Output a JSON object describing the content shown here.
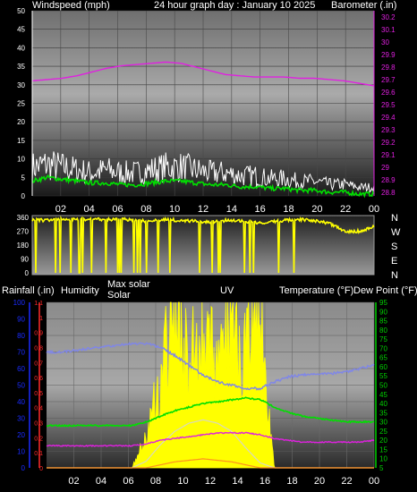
{
  "header": {
    "wind_label": "Windspeed (mph)",
    "title": "24 hour graph day : January 10 2025",
    "baro_label": "Barometer (.in)"
  },
  "lower_labels": {
    "rain": "Rainfall (.in)",
    "humidity": "Humidity",
    "max_solar": "Max solar",
    "solar": "Solar",
    "uv": "UV",
    "temp": "Temperature (°F)",
    "dew": "Dew Point (°F)"
  },
  "direction_labels": [
    "N",
    "W",
    "S",
    "E",
    "N"
  ],
  "x_ticks": [
    "02",
    "04",
    "06",
    "08",
    "10",
    "12",
    "14",
    "16",
    "18",
    "20",
    "22",
    "00"
  ],
  "colors": {
    "wind_avg": "#00e000",
    "wind_gust": "#ffffff",
    "barometer": "#e020e0",
    "direction": "#ffff00",
    "solar": "#ffff00",
    "max_solar": "#d8d8c0",
    "uv": "#ff9020",
    "temperature": "#00e000",
    "dew_point": "#e020e0",
    "humidity": "#7f86e8",
    "rain_axis": "#1a2cff",
    "uv_axis": "#ff2a2a",
    "temp_axis": "#00d000"
  },
  "chart_data": [
    {
      "type": "line",
      "name": "wind-barometer",
      "x": [
        "02",
        "04",
        "06",
        "08",
        "10",
        "12",
        "14",
        "16",
        "18",
        "20",
        "22",
        "00"
      ],
      "y_left": {
        "ticks": [
          0,
          5,
          10,
          15,
          20,
          25,
          30,
          35,
          40,
          45,
          50
        ],
        "ylim": [
          0,
          50
        ]
      },
      "y_right": {
        "ticks": [
          28.8,
          28.9,
          29.0,
          29.1,
          29.2,
          29.3,
          29.4,
          29.5,
          29.6,
          29.7,
          29.8,
          29.9,
          30.0,
          30.1,
          30.2
        ],
        "tick_labels": [
          "28.8",
          "28.9",
          "29",
          "29.1",
          "29.2",
          "29.3",
          "29.4",
          "29.5",
          "29.6",
          "29.7",
          "29.8",
          "29.9",
          "30",
          "30.1",
          "30.2"
        ],
        "ylim": [
          28.77,
          30.25
        ]
      },
      "series": [
        {
          "name": "Windspeed",
          "axis": "left",
          "values": [
            4,
            5,
            4.5,
            4,
            3.5,
            3.5,
            3,
            3,
            3.5,
            4,
            4,
            3.5,
            3,
            3,
            2.5,
            2.5,
            2,
            2,
            1.5,
            1.5,
            1,
            1,
            0.5,
            0.5
          ]
        },
        {
          "name": "Gust",
          "axis": "left",
          "values": [
            10,
            11,
            10,
            9,
            8,
            9,
            8,
            8,
            9,
            10,
            10,
            9,
            8,
            8,
            7,
            7,
            6,
            6,
            5,
            5,
            4,
            4,
            3,
            3
          ]
        },
        {
          "name": "Barometer",
          "axis": "right",
          "values": [
            29.69,
            29.7,
            29.71,
            29.73,
            29.76,
            29.79,
            29.81,
            29.82,
            29.83,
            29.84,
            29.83,
            29.8,
            29.77,
            29.74,
            29.73,
            29.72,
            29.72,
            29.72,
            29.71,
            29.71,
            29.7,
            29.69,
            29.67,
            29.65
          ]
        }
      ]
    },
    {
      "type": "line",
      "name": "wind-direction",
      "x": [
        "02",
        "04",
        "06",
        "08",
        "10",
        "12",
        "14",
        "16",
        "18",
        "20",
        "22",
        "00"
      ],
      "y": {
        "ticks": [
          0,
          90,
          180,
          270,
          360
        ],
        "ylim": [
          0,
          360
        ]
      },
      "series": [
        {
          "name": "Direction",
          "values": [
            345,
            340,
            350,
            345,
            350,
            345,
            350,
            340,
            335,
            345,
            340,
            335,
            330,
            340,
            335,
            325,
            330,
            340,
            345,
            340,
            320,
            270,
            270,
            300
          ]
        }
      ]
    },
    {
      "type": "area",
      "name": "solar-temperature",
      "x": [
        "02",
        "04",
        "06",
        "08",
        "10",
        "12",
        "14",
        "16",
        "18",
        "20",
        "22",
        "00"
      ],
      "y_rain": {
        "ticks": [
          0,
          10,
          20,
          30,
          40,
          50,
          60,
          70,
          80,
          90,
          100
        ],
        "ylim": [
          0,
          100
        ]
      },
      "y_uv": {
        "ticks": [
          0,
          0.1,
          0.2,
          0.3,
          0.4,
          0.5,
          0.6,
          0.7,
          0.8,
          0.9,
          1,
          1.1
        ],
        "tick_labels": [
          "0",
          "0.1",
          "0.2",
          "0.3",
          "0.4",
          "0.5",
          "0.6",
          "0.7",
          "0.8",
          "0.9",
          "1",
          "1.1"
        ],
        "ylim": [
          0,
          1.1
        ]
      },
      "y_temp": {
        "ticks": [
          5,
          10,
          15,
          20,
          25,
          30,
          35,
          40,
          45,
          50,
          55,
          60,
          65,
          70,
          75,
          80,
          85,
          90,
          95
        ],
        "ylim": [
          5,
          95
        ]
      },
      "series": [
        {
          "name": "Temperature",
          "axis": "temp",
          "values": [
            28,
            28,
            28,
            28,
            28,
            28,
            28,
            30,
            33,
            36,
            38,
            40,
            41,
            42,
            43,
            42,
            38,
            35,
            33,
            32,
            31,
            30,
            30,
            30
          ]
        },
        {
          "name": "Dew Point",
          "axis": "temp",
          "values": [
            17,
            17,
            17,
            17,
            17,
            17,
            17,
            18,
            20,
            21,
            22,
            23,
            24,
            24,
            24,
            23,
            21,
            20,
            19,
            19,
            19,
            19,
            19,
            20
          ]
        },
        {
          "name": "Humidity",
          "axis": "rain",
          "values": [
            70,
            70,
            71,
            72,
            73,
            74,
            75,
            75,
            73,
            68,
            62,
            56,
            52,
            50,
            48,
            48,
            52,
            55,
            56,
            57,
            57,
            58,
            60,
            62
          ]
        },
        {
          "name": "Solar",
          "axis": "rain",
          "values": [
            0,
            0,
            0,
            0,
            0,
            0,
            0,
            20,
            55,
            100,
            60,
            95,
            55,
            100,
            70,
            90,
            0,
            0,
            0,
            0,
            0,
            0,
            0,
            0
          ]
        },
        {
          "name": "Max solar",
          "axis": "rain",
          "values": [
            0,
            0,
            0,
            0,
            0,
            0,
            0,
            4,
            14,
            22,
            27,
            29,
            27,
            22,
            12,
            3,
            0,
            0,
            0,
            0,
            0,
            0,
            0,
            0
          ]
        },
        {
          "name": "UV",
          "axis": "uv",
          "values": [
            0,
            0,
            0,
            0,
            0,
            0,
            0,
            0,
            0.02,
            0.04,
            0.05,
            0.06,
            0.05,
            0.04,
            0.02,
            0,
            0,
            0,
            0,
            0,
            0,
            0,
            0,
            0
          ]
        }
      ]
    }
  ]
}
